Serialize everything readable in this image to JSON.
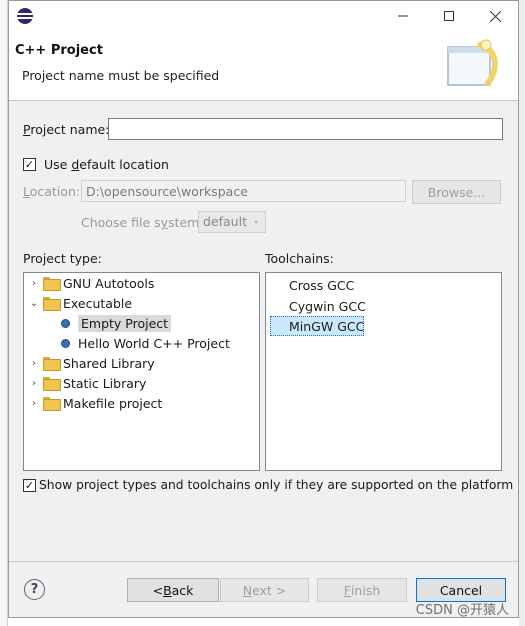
{
  "wizard": {
    "title": "C++ Project",
    "message": "Project name must be specified"
  },
  "project_name": {
    "prefix": "",
    "underline": "P",
    "rest": "roject name:",
    "value": ""
  },
  "use_default_location": {
    "pre": "Use ",
    "underline": "d",
    "rest": "efault location",
    "checked": "✓"
  },
  "location": {
    "underline": "L",
    "rest": "ocation:",
    "value": "D:\\opensource\\workspace",
    "browse_label": "Browse..."
  },
  "file_system": {
    "pre": "Choose file s",
    "underline": "y",
    "rest": "stem:",
    "selected": "default"
  },
  "project_type": {
    "label": "Project type:",
    "items": [
      {
        "label": "GNU Autotools"
      },
      {
        "label": "Executable"
      },
      {
        "label": "Empty Project"
      },
      {
        "label": "Hello World C++ Project"
      },
      {
        "label": "Shared Library"
      },
      {
        "label": "Static Library"
      },
      {
        "label": "Makefile project"
      }
    ]
  },
  "toolchains": {
    "label": "Toolchains:",
    "items": [
      "Cross GCC",
      "Cygwin GCC",
      "MinGW GCC"
    ]
  },
  "filter": {
    "label": "Show project types and toolchains only if they are supported on the platform",
    "checked": "✓"
  },
  "buttons": {
    "back": {
      "pre": "< ",
      "underline": "B",
      "rest": "ack"
    },
    "next": {
      "underline": "N",
      "rest": "ext >"
    },
    "finish": {
      "underline": "F",
      "rest": "inish"
    },
    "cancel": "Cancel"
  },
  "help_label": "?",
  "watermark": "CSDN @开猿人"
}
